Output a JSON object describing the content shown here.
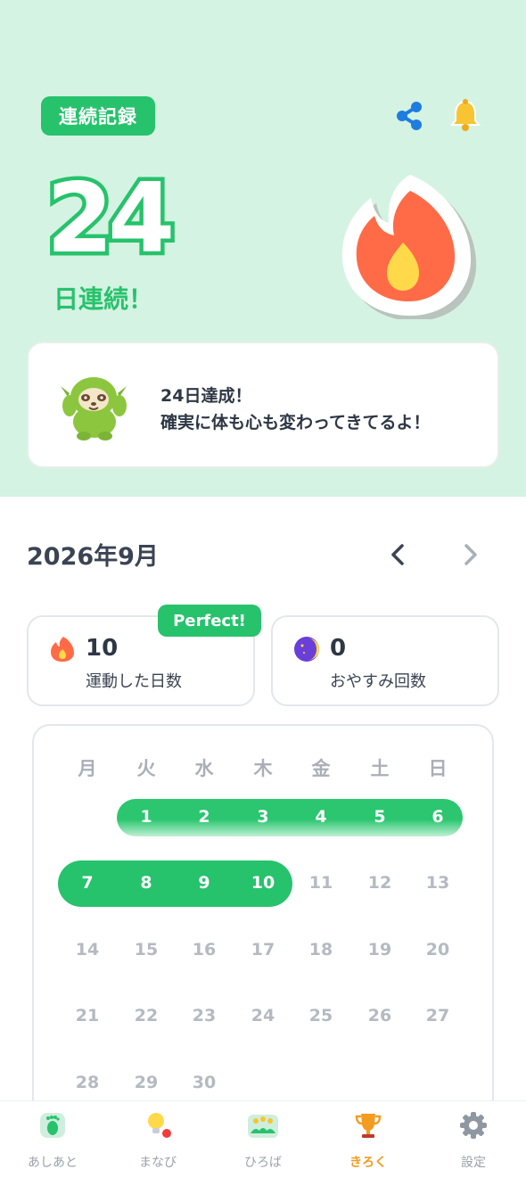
{
  "header": {
    "badge": "連続記録",
    "streak_number": "24",
    "streak_suffix": "日連続！"
  },
  "message": {
    "line1": "24日達成！",
    "line2": "確実に体も心も変わってきてるよ！"
  },
  "calendar": {
    "month_title": "2026年9月",
    "weekdays": [
      "月",
      "火",
      "水",
      "木",
      "金",
      "土",
      "日"
    ],
    "weeks": [
      [
        "",
        "1",
        "2",
        "3",
        "4",
        "5",
        "6"
      ],
      [
        "7",
        "8",
        "9",
        "10",
        "11",
        "12",
        "13"
      ],
      [
        "14",
        "15",
        "16",
        "17",
        "18",
        "19",
        "20"
      ],
      [
        "21",
        "22",
        "23",
        "24",
        "25",
        "26",
        "27"
      ],
      [
        "28",
        "29",
        "30",
        "",
        "",
        "",
        ""
      ]
    ],
    "active_days": [
      1,
      2,
      3,
      4,
      5,
      6,
      7,
      8,
      9,
      10
    ]
  },
  "stats": {
    "exercise": {
      "value": "10",
      "label": "運動した日数",
      "badge": "Perfect!"
    },
    "rest": {
      "value": "0",
      "label": "おやすみ回数"
    }
  },
  "tabs": [
    {
      "label": "あしあと",
      "icon": "footprint-icon"
    },
    {
      "label": "まなび",
      "icon": "lightbulb-icon"
    },
    {
      "label": "ひろば",
      "icon": "community-icon"
    },
    {
      "label": "きろく",
      "icon": "trophy-icon",
      "active": true
    },
    {
      "label": "設定",
      "icon": "gear-icon"
    }
  ],
  "colors": {
    "accent": "#27c26c",
    "header_bg": "#d5f3e2",
    "flame": "#ff6b47",
    "active_tab": "#f39c1f"
  }
}
